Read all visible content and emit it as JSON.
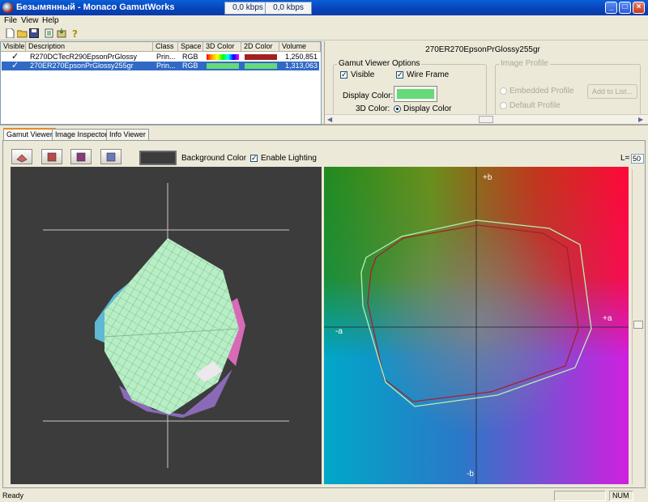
{
  "window": {
    "title": "Безымянный - Monaco GamutWorks",
    "net_in": "0,0 kbps",
    "net_out": "0,0 kbps",
    "btn_minimize": "_",
    "btn_maximize": "□",
    "btn_close": "×"
  },
  "menu": [
    "File",
    "View",
    "Help"
  ],
  "toolbar": {
    "icons": [
      "new-file-icon",
      "open-folder-icon",
      "save-icon",
      "properties-icon",
      "import-icon",
      "help-icon"
    ]
  },
  "profile_list": {
    "headers": [
      "Visible",
      "Description",
      "Class",
      "Space",
      "3D Color",
      "2D Color",
      "Volume"
    ],
    "rows": [
      {
        "visible": "✓",
        "description": "R270DCTecR290EpsonPrGlossy",
        "class": "Prin...",
        "space": "RGB",
        "color3d": "rainbow",
        "color2d": "#a42020",
        "volume": "1,250,851",
        "selected": false
      },
      {
        "visible": "✓",
        "description": "270ER270EpsonPrGlossy255gr",
        "class": "Prin...",
        "space": "RGB",
        "color3d": "#66d97a",
        "color2d": "#66d97a",
        "volume": "1,313,063",
        "selected": true
      }
    ]
  },
  "options": {
    "profile_name": "270ER270EpsonPrGlossy255gr",
    "group_title": "Gamut Viewer Options",
    "visible_label": "Visible",
    "visible_checked": "✓",
    "wireframe_label": "Wire Frame",
    "wireframe_checked": "✓",
    "display_color_label": "Display Color:",
    "display_color": "#66d97a",
    "color3d_label": "3D Color:",
    "color3d_option": "Display Color",
    "image_profile_title": "Image Profile",
    "embedded_profile": "Embedded Profile",
    "default_profile": "Default Profile",
    "add_to_list": "Add to List..."
  },
  "tabs": [
    "Gamut Viewer",
    "Image Inspector",
    "Info Viewer"
  ],
  "viewer": {
    "background_color_label": "Background Color",
    "background_color": "#3c3c3c",
    "enable_lighting_label": "Enable Lighting",
    "enable_lighting_checked": "✓",
    "l_label": "L=",
    "l_value": "50",
    "axis_plus_b": "+b",
    "axis_minus_b": "-b",
    "axis_plus_a": "+a",
    "axis_minus_a": "-a"
  },
  "status": {
    "text": "Ready",
    "num": "NUM"
  }
}
